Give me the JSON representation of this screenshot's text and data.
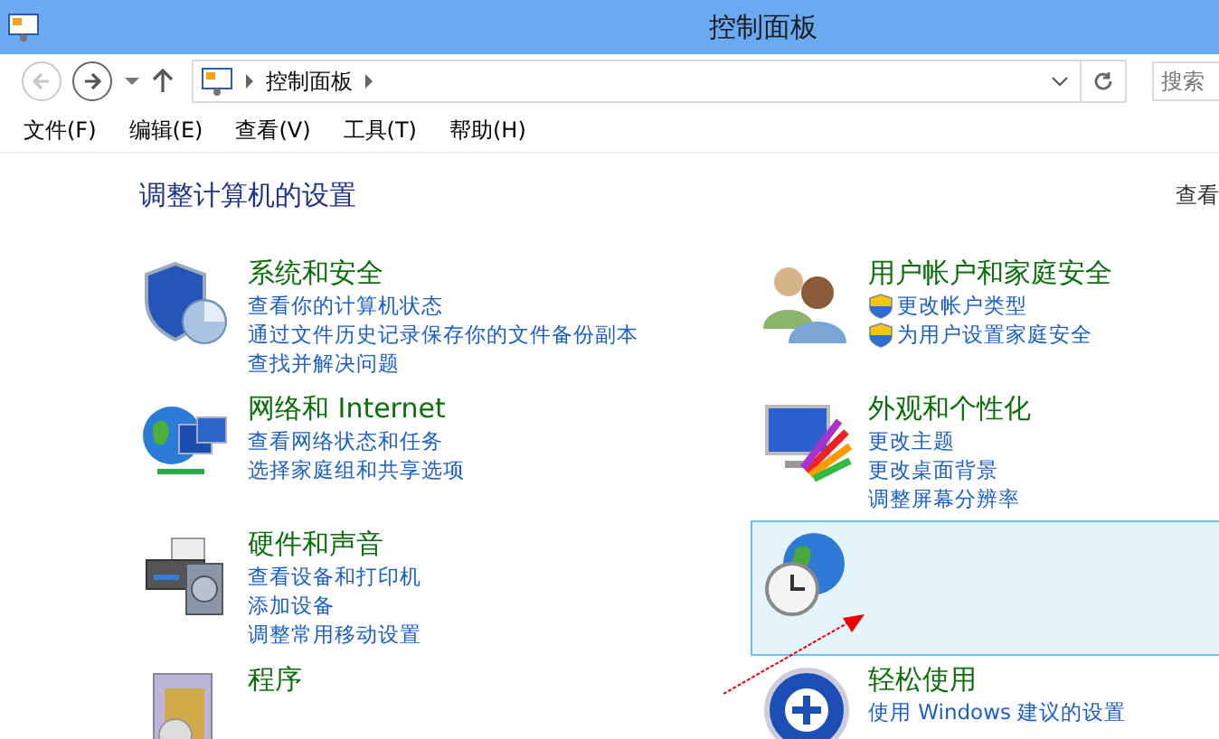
{
  "window": {
    "title": "控制面板"
  },
  "nav": {
    "path": "控制面板",
    "search_placeholder": "搜索"
  },
  "menu": [
    "文件(F)",
    "编辑(E)",
    "查看(V)",
    "工具(T)",
    "帮助(H)"
  ],
  "content": {
    "heading": "调整计算机的设置",
    "view_label": "查看",
    "categories": [
      {
        "kind": "security",
        "highlighted": false,
        "title": "系统和安全",
        "links": [
          {
            "text": "查看你的计算机状态",
            "shield": false
          },
          {
            "text": "通过文件历史记录保存你的文件备份副本",
            "shield": false
          },
          {
            "text": "查找并解决问题",
            "shield": false
          }
        ]
      },
      {
        "kind": "users",
        "highlighted": false,
        "title": "用户帐户和家庭安全",
        "links": [
          {
            "text": "更改帐户类型",
            "shield": true
          },
          {
            "text": "为用户设置家庭安全",
            "shield": true
          }
        ]
      },
      {
        "kind": "network",
        "highlighted": false,
        "title": "网络和 Internet",
        "links": [
          {
            "text": "查看网络状态和任务",
            "shield": false
          },
          {
            "text": "选择家庭组和共享选项",
            "shield": false
          }
        ]
      },
      {
        "kind": "appearance",
        "highlighted": false,
        "title": "外观和个性化",
        "links": [
          {
            "text": "更改主题",
            "shield": false
          },
          {
            "text": "更改桌面背景",
            "shield": false
          },
          {
            "text": "调整屏幕分辨率",
            "shield": false
          }
        ]
      },
      {
        "kind": "hardware",
        "highlighted": false,
        "title": "硬件和声音",
        "links": [
          {
            "text": "查看设备和打印机",
            "shield": false
          },
          {
            "text": "添加设备",
            "shield": false
          },
          {
            "text": "调整常用移动设置",
            "shield": false
          }
        ]
      },
      {
        "kind": "clock",
        "highlighted": true
      },
      {
        "kind": "programs",
        "highlighted": false,
        "title": "程序"
      },
      {
        "kind": "access",
        "highlighted": false,
        "title": "轻松使用",
        "links": [
          {
            "text": "使用 Windows 建议的设置",
            "shield": false
          }
        ]
      }
    ]
  }
}
